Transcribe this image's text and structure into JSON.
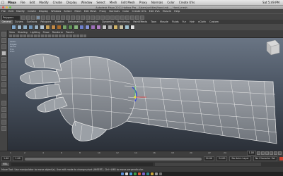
{
  "mac_menubar": {
    "app_name": "Maya",
    "items": [
      "File",
      "Edit",
      "Modify",
      "Create",
      "Display",
      "Window",
      "Select",
      "Mesh",
      "Edit Mesh",
      "Proxy",
      "Normals",
      "Color",
      "Create UVs"
    ],
    "right": [
      "Sat 5:49 PM"
    ]
  },
  "window_title": "Autodesk Maya 2011 Hotbox Pro - /Users/untitled/hand.mb --- Hand_mesh",
  "maya_menu": [
    "File",
    "Edit",
    "Modify",
    "Create",
    "Display",
    "Window",
    "Select",
    "Mesh",
    "Edit Mesh",
    "Proxy",
    "Normals",
    "Color",
    "Create UVs",
    "Edit UVs",
    "Muscle",
    "Help"
  ],
  "status_line": {
    "mode": "Polygons"
  },
  "shelf_tabs": {
    "active": "General",
    "items": [
      "General",
      "Curves",
      "Surfaces",
      "Polygons",
      "Subdivs",
      "Deformation",
      "Animation",
      "Dynamics",
      "Rendering",
      "PaintEffects",
      "Toon",
      "Muscle",
      "Fluids",
      "Fur",
      "Hair",
      "nCloth",
      "Custom"
    ]
  },
  "panel_menu": [
    "View",
    "Shading",
    "Lighting",
    "Show",
    "Renderer",
    "Panels"
  ],
  "viewport_overlay": [
    "Verts:",
    "Edges:",
    "Faces:",
    "Tris:",
    "UVs:"
  ],
  "time_slider": {
    "ticks": [
      "1",
      "2",
      "4",
      "6",
      "8",
      "10",
      "12",
      "14",
      "16",
      "18",
      "20",
      "22",
      "24"
    ],
    "current": "1.00"
  },
  "range_slider": {
    "start": "1.00",
    "inner_start": "1.00",
    "inner_end": "24.00",
    "end": "24.00",
    "anim_layer": "No Anim Layer",
    "character": "No Character Set"
  },
  "command_line": {
    "lang": "MEL"
  },
  "help_line": "Move Tool: Use manipulator to move object(s). Use edit mode to change pivot (INSERT). Ctrl+LMB to move perpendicular.",
  "colors": {
    "viewport_top": "#6a7584",
    "viewport_bottom": "#2b3038",
    "wire": "#e8e8e8",
    "mesh": "#8f949a",
    "selected": "#3e4fd0"
  },
  "icons": [
    "apple-icon",
    "select-tool-icon",
    "lasso-tool-icon",
    "move-tool-icon",
    "rotate-tool-icon",
    "scale-tool-icon",
    "view-cube-icon",
    "play-icon",
    "key-icon"
  ]
}
